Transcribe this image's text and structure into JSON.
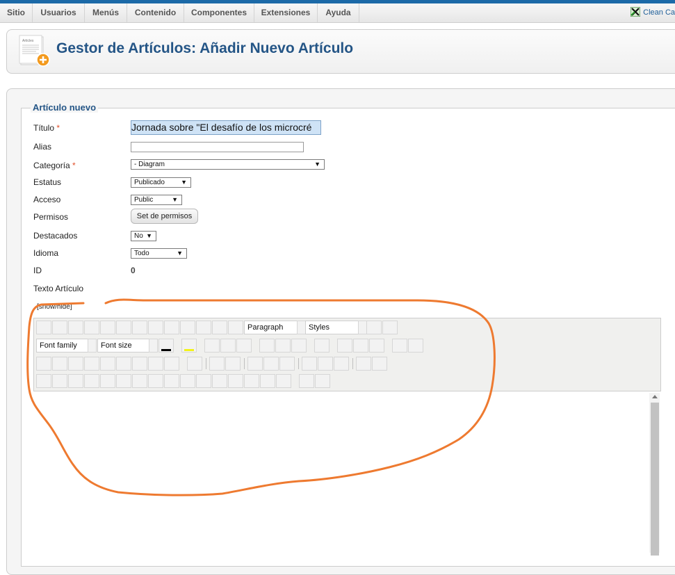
{
  "menu": [
    "Sitio",
    "Usuarios",
    "Menús",
    "Contenido",
    "Componentes",
    "Extensiones",
    "Ayuda"
  ],
  "clean_cache": "Clean Ca",
  "page_title": "Gestor de Artículos: Añadir Nuevo Artículo",
  "icon_caption": "Articles",
  "legend": "Artículo nuevo",
  "form": {
    "titulo_label": "Título",
    "required_mark": "*",
    "titulo_value": "Jornada sobre \"El desafío de los microcré",
    "alias_label": "Alias",
    "alias_value": "",
    "categoria_label": "Categoría",
    "categoria_value": "- Diagram",
    "estatus_label": "Estatus",
    "estatus_value": "Publicado",
    "acceso_label": "Acceso",
    "acceso_value": "Public",
    "permisos_label": "Permisos",
    "permisos_button": "Set de permisos",
    "destacados_label": "Destacados",
    "destacados_value": "No",
    "idioma_label": "Idioma",
    "idioma_value": "Todo",
    "id_label": "ID",
    "id_value": "0",
    "texto_label": "Texto Artículo"
  },
  "editor": {
    "show_hide": "[show/hide]",
    "paragraph": "Paragraph",
    "styles": "Styles",
    "font_family": "Font family",
    "font_size": "Font size",
    "text_color": "#000000",
    "highlight_color": "#f2f21a"
  },
  "annotation_color": "#ee7a30"
}
